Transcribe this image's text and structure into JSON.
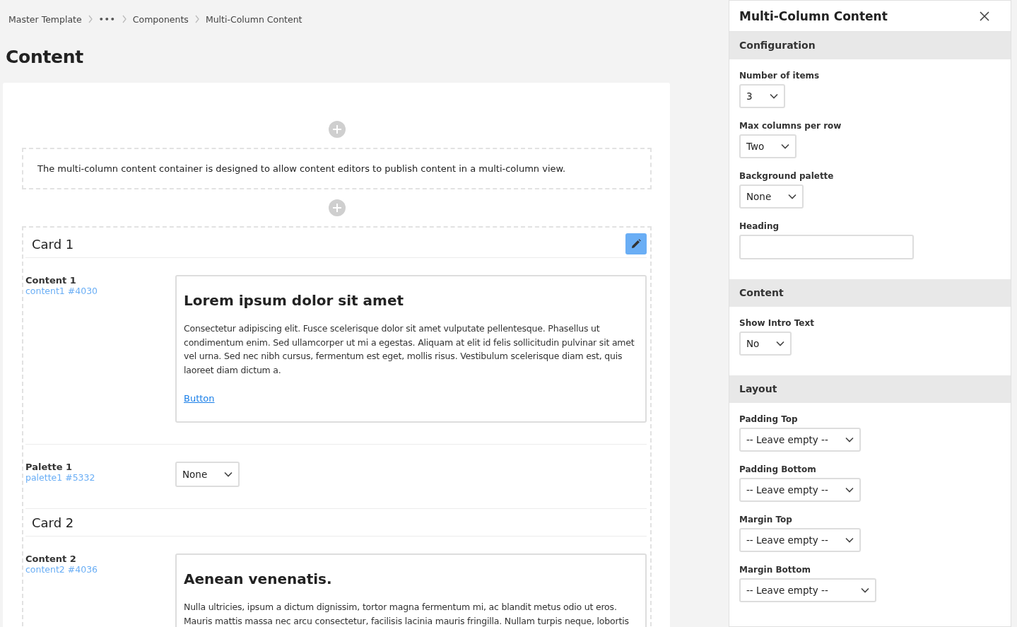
{
  "breadcrumb": [
    {
      "kind": "link",
      "label": "Master Template"
    },
    {
      "kind": "more",
      "label": "•••"
    },
    {
      "kind": "link",
      "label": "Components"
    },
    {
      "kind": "current",
      "label": "Multi-Column Content"
    }
  ],
  "page_title": "Content",
  "editor": {
    "intro_text": "The multi-column content container is designed to allow content editors to publish content in a multi-column view.",
    "cards": [
      {
        "title": "Card 1",
        "editing": true,
        "fields": [
          {
            "kind": "richtext",
            "label": "Content 1",
            "key": "content1 #4030",
            "heading": "Lorem ipsum dolor sit amet",
            "body": "Consectetur adipiscing elit. Fusce scelerisque dolor sit amet vulputate pellentesque. Phasellus ut condimentum enim. Sed ullamcorper ut mi a egestas. Aliquam at elit id felis sollicitudin pulvinar sit amet vel urna. Sed nec nibh cursus, fermentum est eget, mollis risus. Vestibulum scelerisque diam est, quis laoreet diam dictum a.",
            "link": "Button"
          },
          {
            "kind": "select",
            "label": "Palette 1",
            "key": "palette1 #5332",
            "value": "None"
          }
        ]
      },
      {
        "title": "Card 2",
        "editing": false,
        "fields": [
          {
            "kind": "richtext",
            "label": "Content 2",
            "key": "content2 #4036",
            "heading": "Aenean venenatis.",
            "body": "Nulla ultricies, ipsum a dictum dignissim, tortor magna fermentum mi, ac blandit metus odio ut eros. Mauris mattis massa nec arcu consectetur, facilisis lacinia mauris fringilla. Nullam turpis neque, lobortis"
          }
        ]
      }
    ]
  },
  "panel": {
    "title": "Multi-Column Content",
    "sections": [
      {
        "title": "Configuration",
        "fields": [
          {
            "kind": "select",
            "label": "Number of items",
            "value": "3"
          },
          {
            "kind": "select",
            "label": "Max columns per row",
            "value": "Two"
          },
          {
            "kind": "select",
            "label": "Background palette",
            "value": "None"
          },
          {
            "kind": "text",
            "label": "Heading"
          }
        ]
      },
      {
        "title": "Content",
        "fields": [
          {
            "kind": "select",
            "label": "Show Intro Text",
            "value": "No"
          }
        ]
      },
      {
        "title": "Layout",
        "fields": [
          {
            "kind": "select",
            "label": "Padding Top",
            "value": "-- Leave empty --"
          },
          {
            "kind": "select",
            "label": "Padding Bottom",
            "value": "-- Leave empty --"
          },
          {
            "kind": "select",
            "label": "Margin Top",
            "value": "-- Leave empty --"
          },
          {
            "kind": "select",
            "label": "Margin Bottom",
            "value": "-- Leave empty --"
          }
        ]
      }
    ]
  }
}
